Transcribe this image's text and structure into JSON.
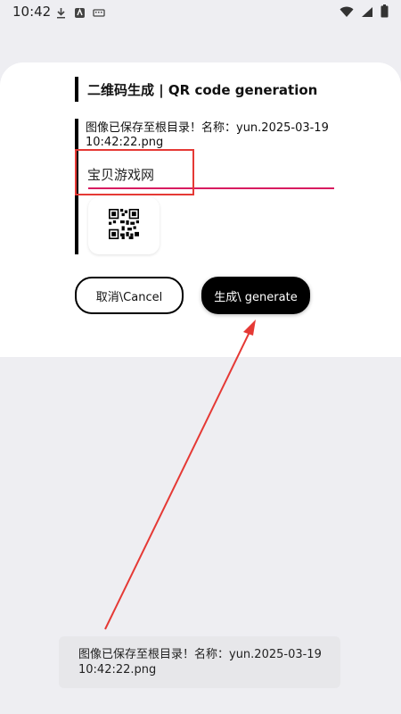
{
  "status_bar": {
    "time": "10:42",
    "icons": [
      "download-icon",
      "android-icon",
      "keyboard-icon",
      "wifi-icon",
      "signal-icon",
      "battery-icon"
    ]
  },
  "dialog": {
    "title": "二维码生成 | QR code generation",
    "saved_message": "图像已保存至根目录！名称：yun.2025-03-19 10:42:22.png",
    "input_value": "宝贝游戏网",
    "qr_icon": "qr-code-icon",
    "cancel_label": "取消\\Cancel",
    "generate_label": "生成\\ generate"
  },
  "toast": {
    "message": "图像已保存至根目录！名称：yun.2025-03-19 10:42:22.png"
  },
  "colors": {
    "background": "#eeeef2",
    "accent_underline": "#d81b60",
    "annotation": "#e53935",
    "primary_button": "#000000"
  }
}
